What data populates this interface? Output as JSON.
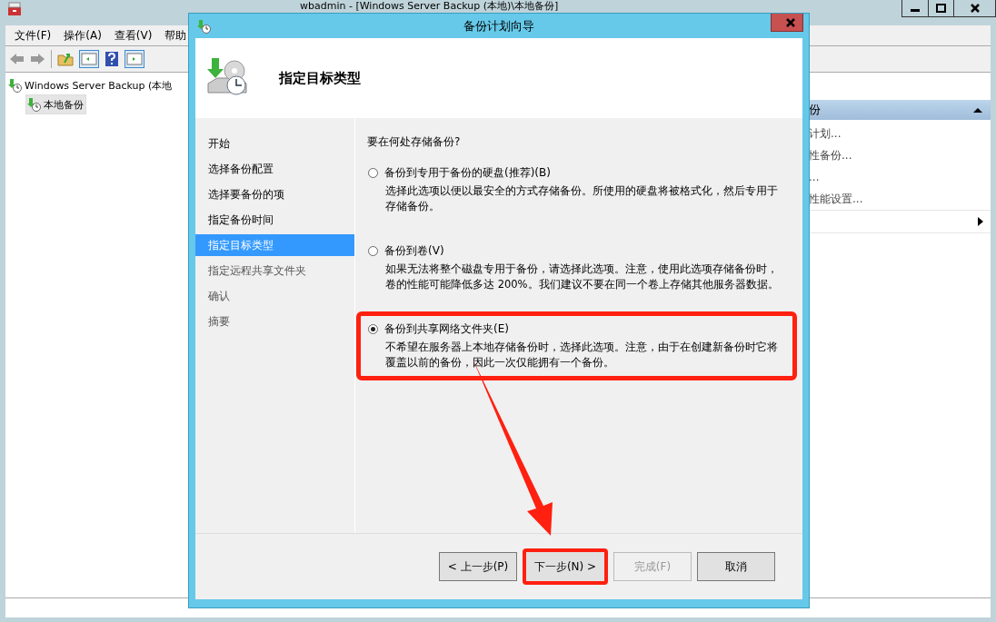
{
  "main_window": {
    "title": "wbadmin - [Windows Server Backup (本地)\\本地备份]",
    "menu": [
      "文件(F)",
      "操作(A)",
      "查看(V)",
      "帮助"
    ],
    "tree": [
      {
        "label": "Windows Server Backup (本地",
        "selected": false,
        "children": [
          {
            "label": "本地备份",
            "selected": true
          }
        ]
      }
    ],
    "actions": [
      {
        "kind": "header",
        "label": "份"
      },
      {
        "kind": "item",
        "label": "计划..."
      },
      {
        "kind": "item",
        "label": "性备份..."
      },
      {
        "kind": "item",
        "label": "..."
      },
      {
        "kind": "item",
        "label": "性能设置..."
      },
      {
        "kind": "submenu"
      }
    ]
  },
  "dialog": {
    "title": "备份计划向导",
    "heading": "指定目标类型",
    "steps": [
      {
        "label": "开始",
        "selected": false,
        "disabled": false
      },
      {
        "label": "选择备份配置",
        "selected": false,
        "disabled": false
      },
      {
        "label": "选择要备份的项",
        "selected": false,
        "disabled": false
      },
      {
        "label": "指定备份时间",
        "selected": false,
        "disabled": false
      },
      {
        "label": "指定目标类型",
        "selected": true,
        "disabled": false
      },
      {
        "label": "指定远程共享文件夹",
        "selected": false,
        "disabled": true
      },
      {
        "label": "确认",
        "selected": false,
        "disabled": true
      },
      {
        "label": "摘要",
        "selected": false,
        "disabled": true
      }
    ],
    "question": "要在何处存储备份?",
    "options": [
      {
        "label": "备份到专用于备份的硬盘(推荐)(B)",
        "description": "选择此选项以便以最安全的方式存储备份。所使用的硬盘将被格式化，然后专用于存储备份。",
        "selected": false,
        "highlighted": false
      },
      {
        "label": "备份到卷(V)",
        "description": "如果无法将整个磁盘专用于备份，请选择此选项。注意，使用此选项存储备份时，卷的性能可能降低多达 200%。我们建议不要在同一个卷上存储其他服务器数据。",
        "selected": false,
        "highlighted": false
      },
      {
        "label": "备份到共享网络文件夹(E)",
        "description": "不希望在服务器上本地存储备份时，选择此选项。注意，由于在创建新备份时它将覆盖以前的备份，因此一次仅能拥有一个备份。",
        "selected": true,
        "highlighted": true
      }
    ],
    "buttons": [
      {
        "label": "< 上一步(P)",
        "disabled": false,
        "highlighted": false
      },
      {
        "label": "下一步(N) >",
        "disabled": false,
        "highlighted": true
      },
      {
        "label": "完成(F)",
        "disabled": true,
        "highlighted": false
      },
      {
        "label": "取消",
        "disabled": false,
        "highlighted": false
      }
    ]
  }
}
